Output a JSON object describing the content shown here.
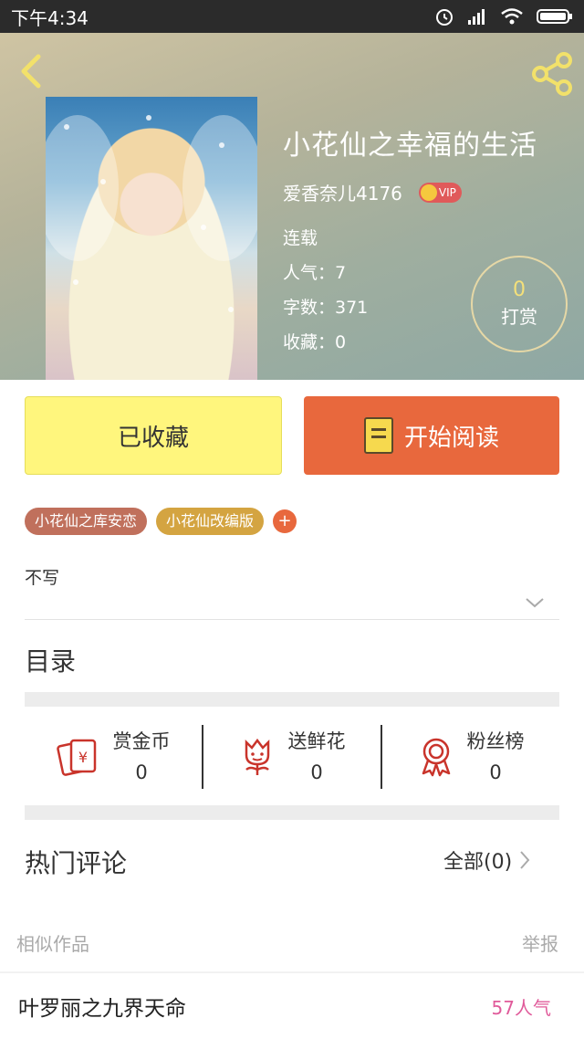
{
  "status_bar": {
    "time": "下午4:34"
  },
  "book": {
    "title": "小花仙之幸福的生活",
    "author": "爱香奈儿4176",
    "vip_label": "VIP",
    "status": "连载",
    "popularity": "人气：7",
    "word_count": "字数：371",
    "favorites": "收藏：0",
    "reward_count": "0",
    "reward_label": "打赏"
  },
  "actions": {
    "collected_label": "已收藏",
    "read_label": "开始阅读"
  },
  "tags": [
    "小花仙之库安恋",
    "小花仙改编版"
  ],
  "tag_add": "+",
  "description": "不写",
  "catalog_label": "目录",
  "stats": [
    {
      "label": "赏金币",
      "value": "0",
      "icon": "coin-envelope-icon"
    },
    {
      "label": "送鲜花",
      "value": "0",
      "icon": "flower-icon"
    },
    {
      "label": "粉丝榜",
      "value": "0",
      "icon": "medal-icon"
    }
  ],
  "comments": {
    "title": "热门评论",
    "all_label": "全部(0)"
  },
  "similar": {
    "label": "相似作品",
    "report_label": "举报",
    "items": [
      {
        "title": "叶罗丽之九界天命",
        "popularity": "57人气"
      }
    ]
  },
  "colors": {
    "accent_orange": "#e8683d",
    "collected_yellow": "#fff67d",
    "popularity_pink": "#e05a9a"
  }
}
